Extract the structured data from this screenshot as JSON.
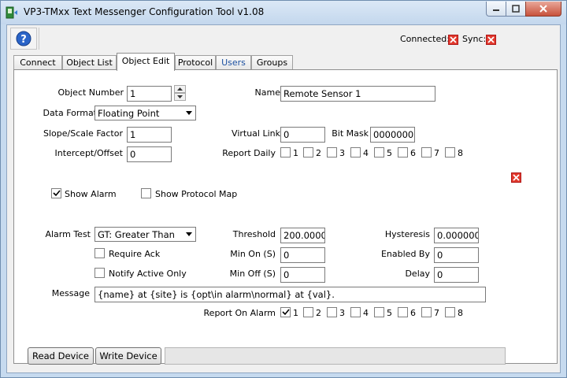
{
  "window": {
    "title": "VP3-TMxx Text Messenger Configuration Tool v1.08"
  },
  "status": {
    "connected_label": "Connected:",
    "sync_label": "Sync:"
  },
  "tabs": [
    {
      "label": "Connect"
    },
    {
      "label": "Object List"
    },
    {
      "label": "Object Edit"
    },
    {
      "label": "Protocol"
    },
    {
      "label": "Users"
    },
    {
      "label": "Groups"
    }
  ],
  "form": {
    "object_number_label": "Object Number",
    "object_number": "1",
    "name_label": "Name",
    "name": "Remote Sensor 1",
    "data_format_label": "Data Format",
    "data_format": "Floating Point",
    "slope_label": "Slope/Scale Factor",
    "slope": "1",
    "virtual_link_label": "Virtual Link",
    "virtual_link": "0",
    "bit_mask_label": "Bit Mask",
    "bit_mask": "00000000",
    "intercept_label": "Intercept/Offset",
    "intercept": "0",
    "report_daily_label": "Report Daily",
    "report_daily": [
      {
        "n": "1",
        "checked": false
      },
      {
        "n": "2",
        "checked": false
      },
      {
        "n": "3",
        "checked": false
      },
      {
        "n": "4",
        "checked": false
      },
      {
        "n": "5",
        "checked": false
      },
      {
        "n": "6",
        "checked": false
      },
      {
        "n": "7",
        "checked": false
      },
      {
        "n": "8",
        "checked": false
      }
    ],
    "show_alarm_label": "Show Alarm",
    "show_alarm": true,
    "show_protocol_map_label": "Show Protocol Map",
    "show_protocol_map": false,
    "alarm_test_label": "Alarm Test",
    "alarm_test": "GT: Greater Than",
    "threshold_label": "Threshold",
    "threshold": "200.000000",
    "hysteresis_label": "Hysteresis",
    "hysteresis": "0.000000",
    "require_ack_label": "Require Ack",
    "require_ack": false,
    "min_on_label": "Min On (S)",
    "min_on": "0",
    "enabled_by_label": "Enabled By",
    "enabled_by": "0",
    "notify_active_label": "Notify Active Only",
    "notify_active": false,
    "min_off_label": "Min Off (S)",
    "min_off": "0",
    "delay_label": "Delay",
    "delay": "0",
    "message_label": "Message",
    "message": "{name} at {site} is {opt\\in alarm\\normal} at {val}.",
    "report_on_alarm_label": "Report On Alarm",
    "report_on_alarm": [
      {
        "n": "1",
        "checked": true
      },
      {
        "n": "2",
        "checked": false
      },
      {
        "n": "3",
        "checked": false
      },
      {
        "n": "4",
        "checked": false
      },
      {
        "n": "5",
        "checked": false
      },
      {
        "n": "6",
        "checked": false
      },
      {
        "n": "7",
        "checked": false
      },
      {
        "n": "8",
        "checked": false
      }
    ]
  },
  "actions": {
    "read_label": "Read Device",
    "write_label": "Write Device"
  },
  "progress": {
    "fraction": 0
  },
  "colors": {
    "alert": "#e23a2e",
    "tab_users_text": "#1c50a0"
  }
}
